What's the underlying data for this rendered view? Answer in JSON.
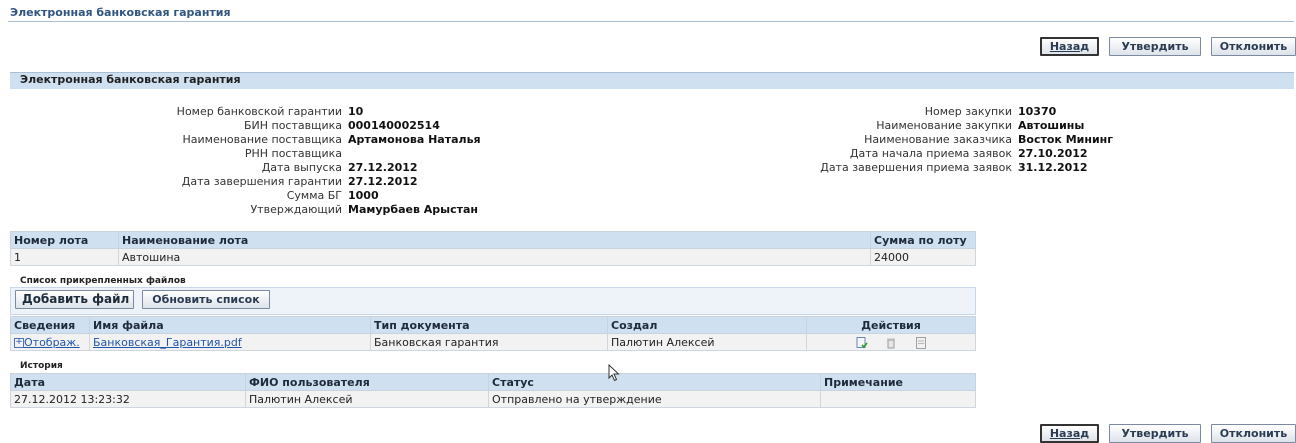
{
  "page": {
    "title": "Электронная банковская гарантия"
  },
  "actions": {
    "back": "Назад",
    "approve": "Утвердить",
    "reject": "Отклонить"
  },
  "section": {
    "title": "Электронная банковская гарантия"
  },
  "details_left": [
    {
      "label": "Номер банковской гарантии",
      "value": "10"
    },
    {
      "label": "БИН поставщика",
      "value": "000140002514"
    },
    {
      "label": "Наименование поставщика",
      "value": "Артамонова Наталья"
    },
    {
      "label": "РНН поставщика",
      "value": ""
    },
    {
      "label": "Дата выпуска",
      "value": "27.12.2012"
    },
    {
      "label": "Дата завершения гарантии",
      "value": "27.12.2012"
    },
    {
      "label": "Сумма БГ",
      "value": "1000"
    },
    {
      "label": "Утверждающий",
      "value": "Мамурбаев Арыстан"
    }
  ],
  "details_right": [
    {
      "label": "Номер закупки",
      "value": "10370"
    },
    {
      "label": "Наименование закупки",
      "value": "Автошины"
    },
    {
      "label": "Наименование заказчика",
      "value": "Восток Мининг"
    },
    {
      "label": "Дата начала приема заявок",
      "value": "27.10.2012"
    },
    {
      "label": "Дата завершения приема заявок",
      "value": "31.12.2012"
    }
  ],
  "lots": {
    "headers": [
      "Номер лота",
      "Наименование лота",
      "Сумма по лоту"
    ],
    "rows": [
      [
        "1",
        "Автошина",
        "24000"
      ]
    ]
  },
  "files": {
    "title": "Список прикрепленных файлов",
    "add_button": "Добавить файл",
    "refresh_button": "Обновить список",
    "headers": [
      "Сведения",
      "Имя файла",
      "Тип документа",
      "Создал",
      "Действия"
    ],
    "rows": [
      {
        "details": "Отображ.",
        "file": "Банковская_Гарантия.pdf",
        "doctype": "Банковская гарантия",
        "author": "Палютин Алексей"
      }
    ]
  },
  "history": {
    "title": "История",
    "headers": [
      "Дата",
      "ФИО пользователя",
      "Статус",
      "Примечание"
    ],
    "rows": [
      [
        "27.12.2012 13:23:32",
        "Палютин Алексей",
        "Отправлено на утверждение",
        ""
      ]
    ]
  },
  "icons": {
    "update": "update-file-icon",
    "delete": "trash-icon",
    "view": "view-file-icon"
  },
  "colors": {
    "header_bg": "#cfe0f1",
    "title_text": "#2f5580",
    "link": "#2255aa"
  }
}
